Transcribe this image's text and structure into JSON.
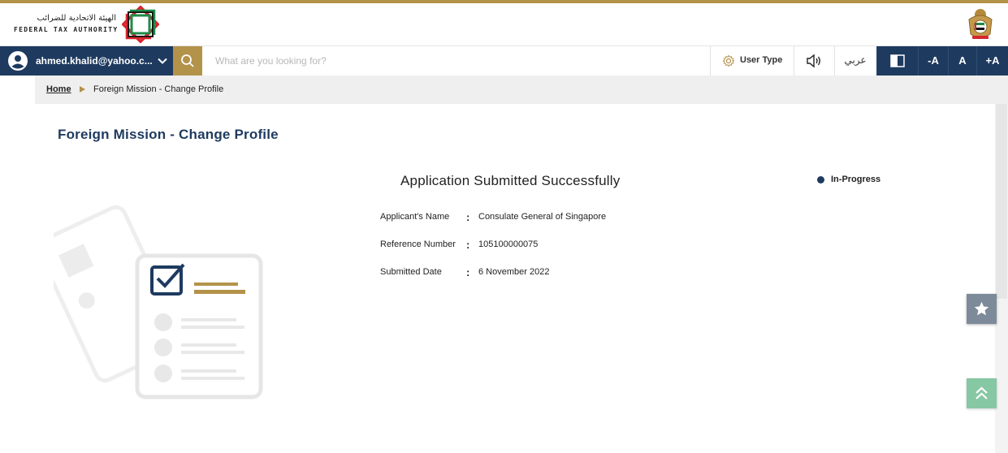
{
  "header": {
    "logo_arabic": "الهيئة الاتحادية للضرائب",
    "logo_english": "FEDERAL TAX AUTHORITY",
    "logo_icon": "fta-logo-icon",
    "emblem_icon": "uae-emblem-icon"
  },
  "navbar": {
    "user_email": "ahmed.khalid@yahoo.c...",
    "search_placeholder": "What are you looking for?",
    "user_type_label": "User Type",
    "language_label": "عربي",
    "font_decrease_label": "-A",
    "font_reset_label": "A",
    "font_increase_label": "+A"
  },
  "breadcrumb": {
    "home": "Home",
    "current": "Foreign Mission - Change Profile"
  },
  "main": {
    "page_title": "Foreign Mission - Change Profile",
    "success_title": "Application Submitted Successfully",
    "status": "In-Progress",
    "details": [
      {
        "label": "Applicant's Name",
        "value": "Consulate General of Singapore"
      },
      {
        "label": "Reference Number",
        "value": "105100000075"
      },
      {
        "label": "Submitted Date",
        "value": "6 November 2022"
      }
    ]
  },
  "colors": {
    "navy": "#1e3a5f",
    "gold": "#b3924a",
    "fav_button": "#7d8a99",
    "scroll_top_button": "#86c7a4"
  }
}
